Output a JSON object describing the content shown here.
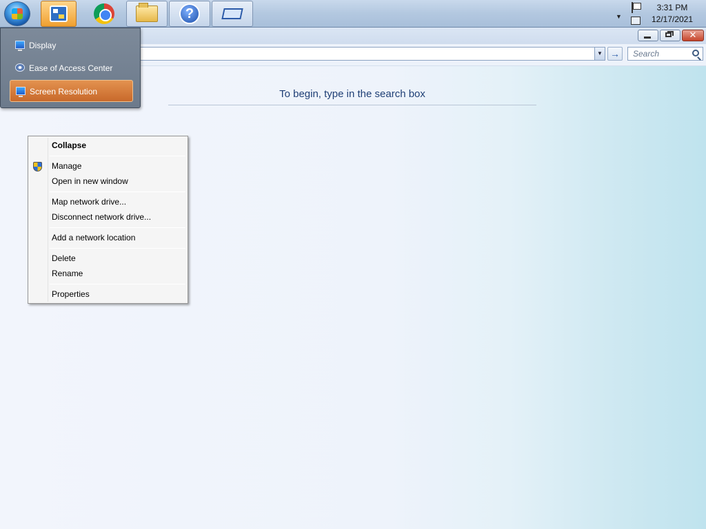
{
  "taskbar": {
    "start_label": "Start",
    "buttons": [
      {
        "name": "control-panel",
        "icon": "control-panel-icon",
        "active": true
      },
      {
        "name": "chrome",
        "icon": "chrome-icon"
      },
      {
        "name": "file-explorer",
        "icon": "folder-icon"
      },
      {
        "name": "help",
        "icon": "help-icon",
        "glyph": "?"
      },
      {
        "name": "remote-desktop",
        "icon": "window-icon"
      }
    ],
    "tray": {
      "time": "3:31 PM",
      "date": "12/17/2021",
      "show_hidden_glyph": "▼"
    }
  },
  "window": {
    "buttons": {
      "close_glyph": "✕"
    },
    "address": {
      "value": "",
      "dropdown_glyph": "▼",
      "go_glyph": "→"
    },
    "search": {
      "placeholder": "Search",
      "value": ""
    },
    "hint_text": "To begin, type in the search box"
  },
  "popup": {
    "items": [
      {
        "label": "Display",
        "icon": "monitor-icon",
        "selected": false
      },
      {
        "label": "Ease of Access Center",
        "icon": "ease-of-access-icon",
        "selected": false
      },
      {
        "label": "Screen Resolution",
        "icon": "monitor-icon",
        "selected": true
      }
    ]
  },
  "context_menu": {
    "items": [
      {
        "label": "Collapse",
        "bold": true
      },
      {
        "label": "Manage",
        "icon": "uac-shield-icon"
      },
      {
        "label": "Open in new window"
      },
      {
        "label": "Map network drive..."
      },
      {
        "label": "Disconnect network drive..."
      },
      {
        "label": "Add a network location"
      },
      {
        "label": "Delete"
      },
      {
        "label": "Rename"
      },
      {
        "label": "Properties"
      }
    ]
  },
  "colors": {
    "popup_selected": "#c8692b",
    "hint_text": "#1f3f75",
    "taskbar_active": "#f0a030"
  }
}
